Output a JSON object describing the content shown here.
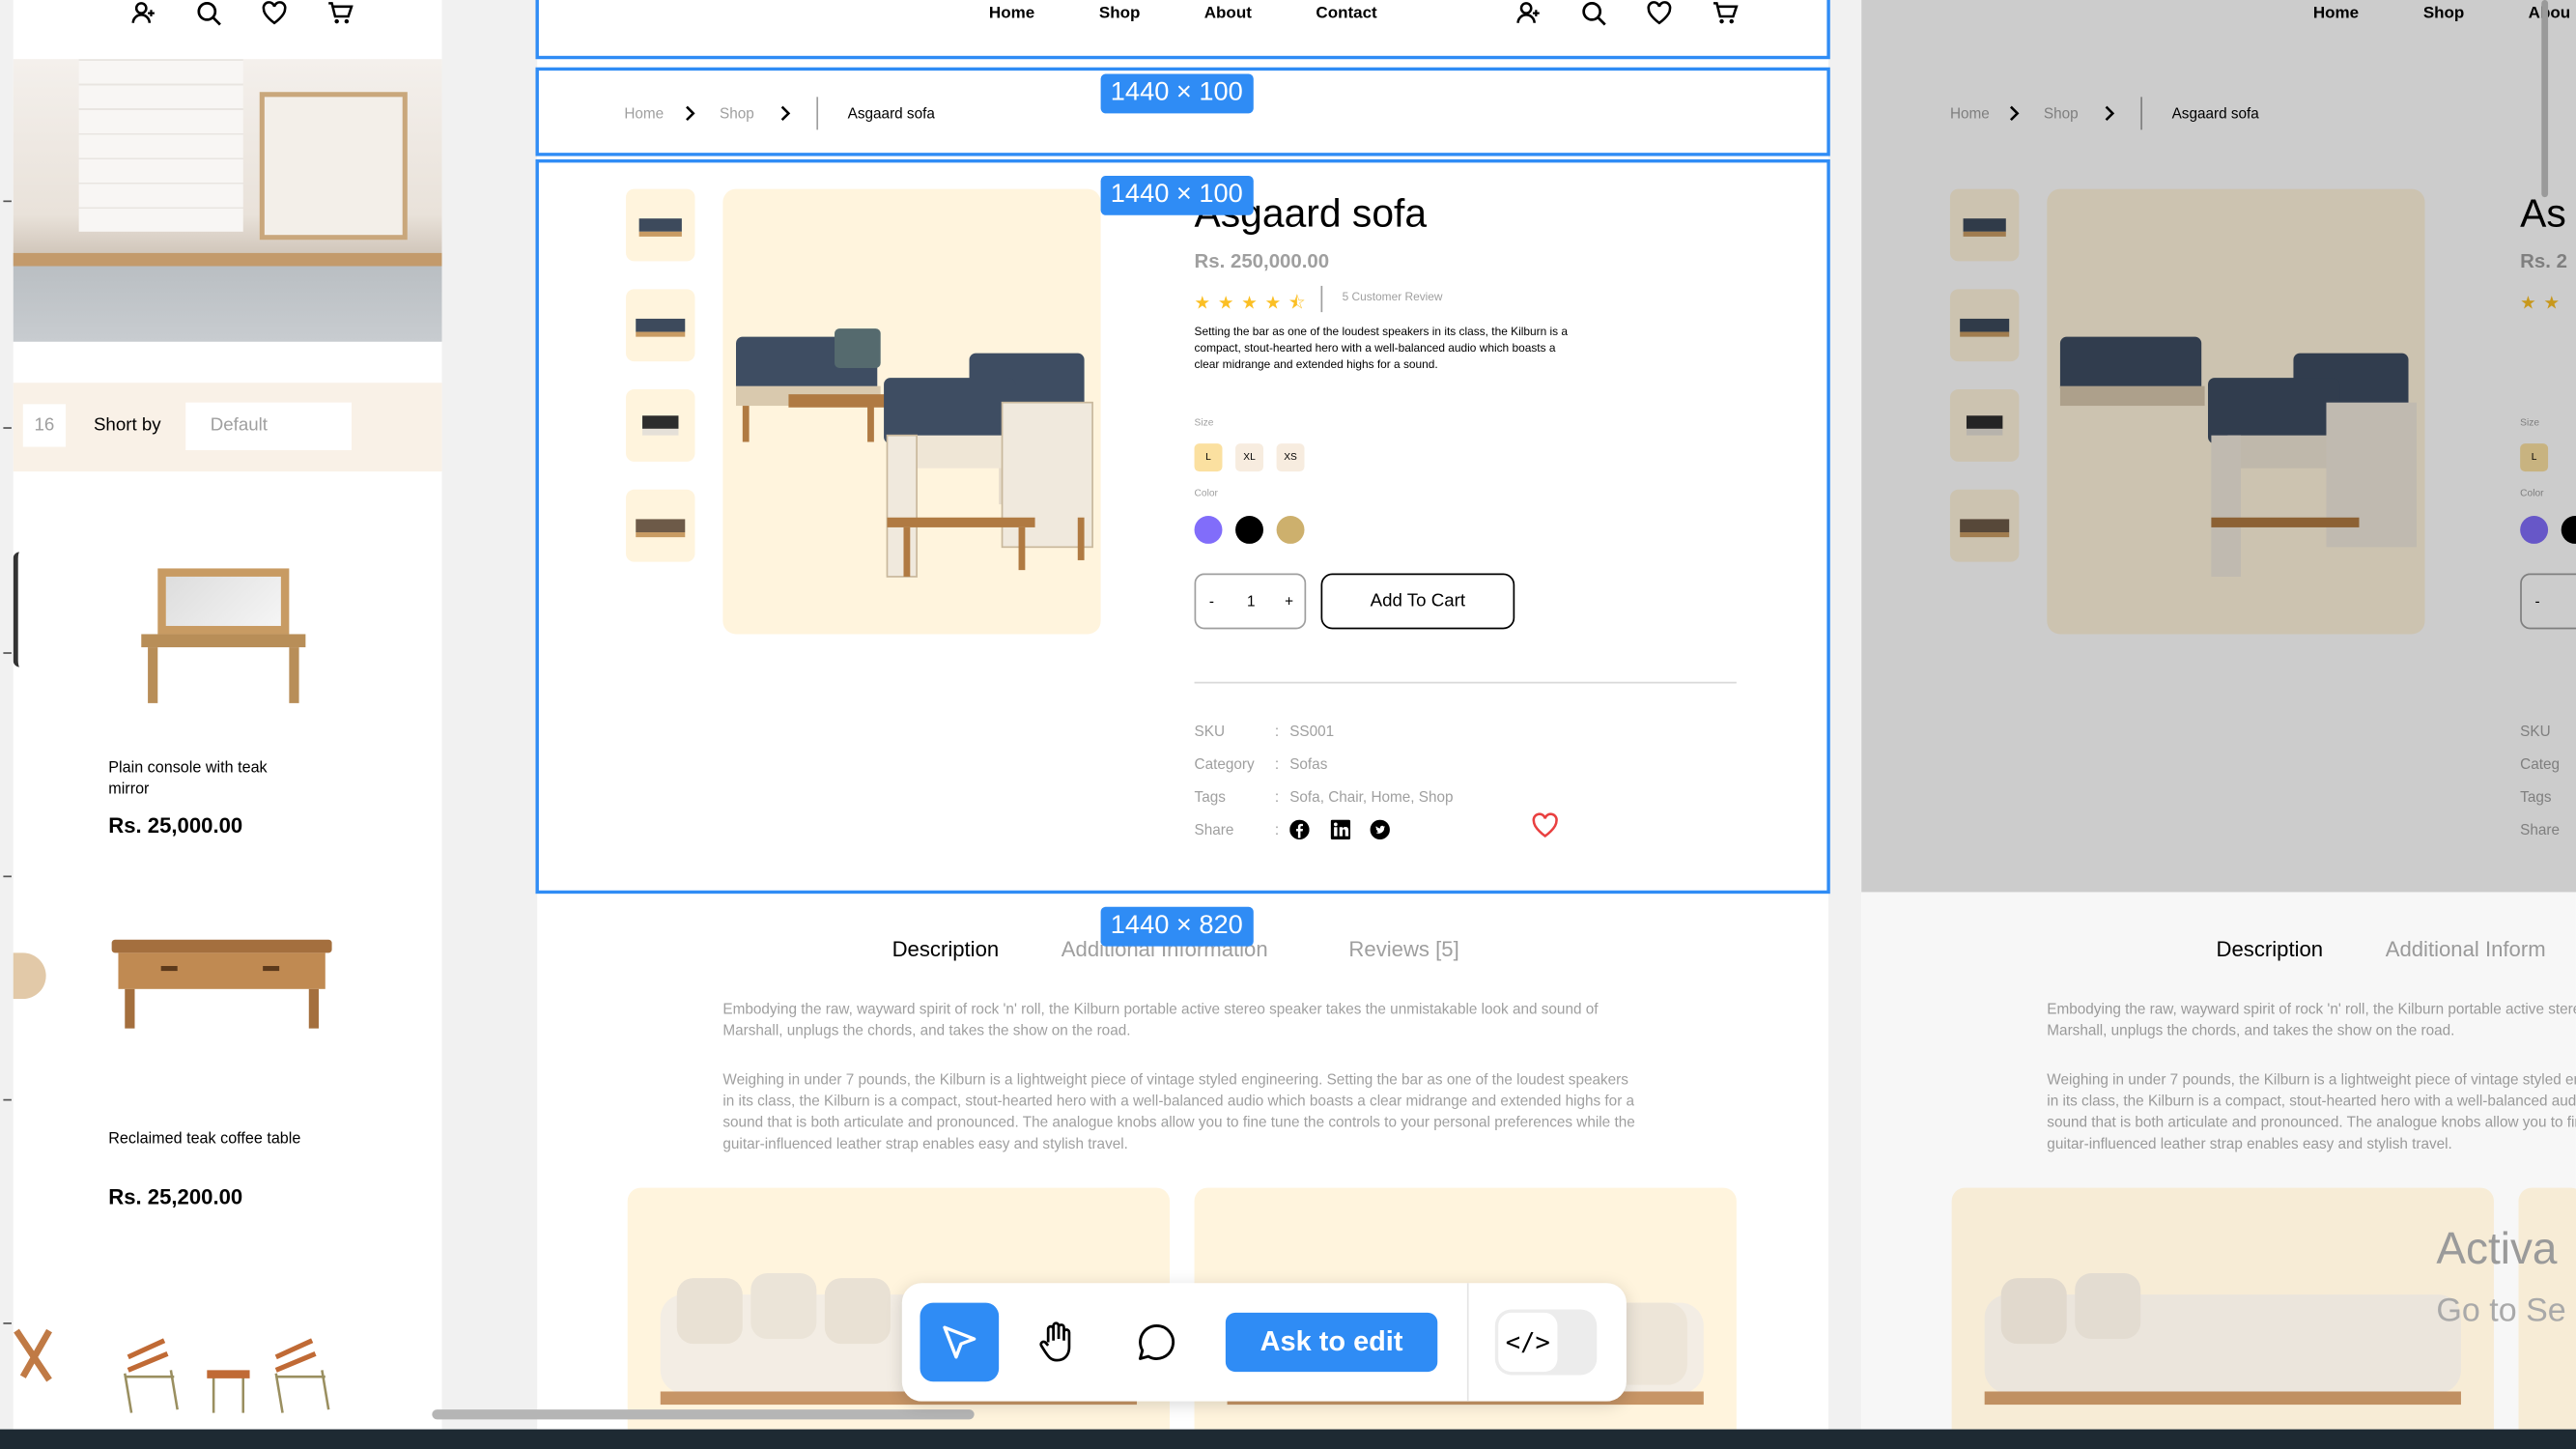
{
  "product": {
    "name": "Asgaard sofa",
    "price": "Rs. 250,000.00",
    "rating": 4.5,
    "review_count": "5 Customer Review",
    "description": "Setting the bar as one of the loudest speakers in its class, the Kilburn is a compact, stout-hearted hero with a well-balanced audio which boasts a clear midrange and extended highs for a sound.",
    "size_label": "Size",
    "sizes": [
      "L",
      "XL",
      "XS"
    ],
    "selected_size": "L",
    "color_label": "Color",
    "colors": [
      "#816dfa",
      "#000000",
      "#b88e2f"
    ],
    "quantity": "1",
    "minus": "-",
    "plus": "+",
    "add_to_cart": "Add To Cart",
    "meta": {
      "sku_label": "SKU",
      "sku": "SS001",
      "category_label": "Category",
      "category": "Sofas",
      "tags_label": "Tags",
      "tags": "Sofa, Chair, Home, Shop",
      "share_label": "Share",
      "colon": ":"
    }
  },
  "nav": {
    "home": "Home",
    "shop": "Shop",
    "about": "About",
    "contact": "Contact",
    "about_cut": "Abou"
  },
  "breadcrumb": {
    "home": "Home",
    "shop": "Shop",
    "current": "Asgaard sofa"
  },
  "tabs": {
    "description": "Description",
    "additional": "Additional Information",
    "additional_cut": "Additional Inform",
    "reviews": "Reviews [5]"
  },
  "description_text": {
    "p1": "Embodying the raw, wayward spirit of rock 'n' roll, the Kilburn portable active stereo speaker takes the unmistakable look and sound of Marshall, unplugs the chords, and takes the show on the road.",
    "p2": "Weighing in under 7 pounds, the Kilburn is a lightweight piece of vintage styled engineering. Setting the bar as one of the loudest speakers in its class, the Kilburn is a compact, stout-hearted hero with a well-balanced audio which boasts a clear midrange and extended highs for a sound that is both articulate and pronounced. The analogue knobs allow you to fine tune the controls to your personal preferences while the guitar-influenced leather strap enables easy and stylish travel."
  },
  "dimensions": {
    "header": "1440 × 100",
    "main": "1440 × 100",
    "detail": "1440 × 820"
  },
  "left_panel": {
    "count": "16",
    "sort_label": "Short by",
    "sort_value": "Default",
    "products": [
      {
        "name": "Plain console with teak mirror",
        "price": "Rs. 25,000.00"
      },
      {
        "name": "Reclaimed teak coffee table",
        "price": "Rs. 25,200.00"
      }
    ]
  },
  "right_panel": {
    "title_cut": "As",
    "price_cut": "Rs. 2",
    "sku_cut": "SKU",
    "category_cut": "Categ",
    "tags_cut": "Tags",
    "share_cut": "Share",
    "size_cut": "Size",
    "color_cut": "Color",
    "selected_size": "L"
  },
  "toolbar": {
    "ask_to_edit": "Ask to edit",
    "code_label": "</>"
  },
  "watermark": {
    "line1": "Activa",
    "line2": "Go to Se"
  },
  "colors": {
    "accent": "#2f8cf5",
    "cream": "#fff4dd",
    "gold": "#b88e2f",
    "star": "#fbbf24",
    "like": "#e94040"
  }
}
